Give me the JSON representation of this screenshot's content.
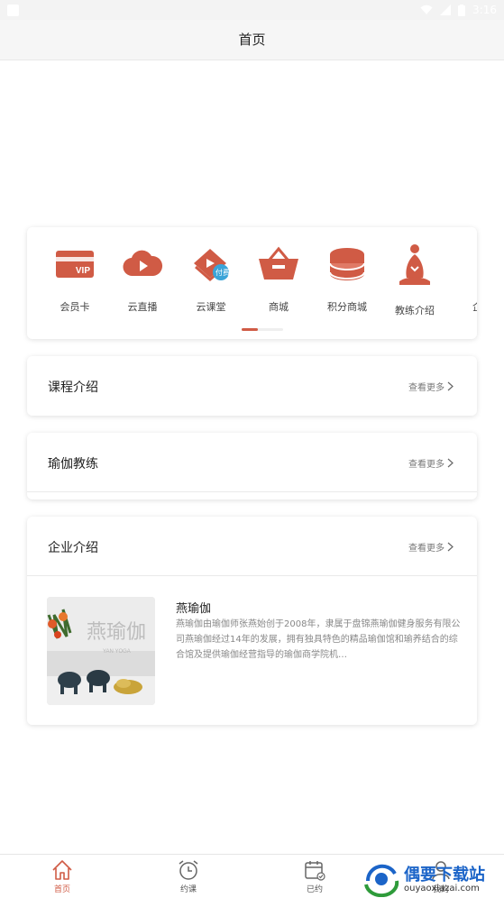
{
  "status_bar": {
    "time": "3:16"
  },
  "header": {
    "title": "首页"
  },
  "menu": {
    "items": [
      {
        "label": "会员卡",
        "icon": "vip-card-icon"
      },
      {
        "label": "云直播",
        "icon": "cloud-live-icon"
      },
      {
        "label": "云课堂",
        "icon": "cloud-class-icon",
        "badge": "付费"
      },
      {
        "label": "商城",
        "icon": "shop-basket-icon"
      },
      {
        "label": "积分商城",
        "icon": "points-coins-icon"
      },
      {
        "label": "教练介绍",
        "icon": "yoga-coach-icon"
      },
      {
        "label": "企业",
        "icon": "company-icon"
      }
    ],
    "vip_text": "VIP"
  },
  "sections": {
    "course": {
      "title": "课程介绍",
      "more": "查看更多"
    },
    "coach": {
      "title": "瑜伽教练",
      "more": "查看更多"
    },
    "company": {
      "title": "企业介绍",
      "more": "查看更多",
      "name": "燕瑜伽",
      "description": "燕瑜伽由瑜伽师张燕始创于2008年，隶属于盘锦燕瑜伽健身服务有限公司燕瑜伽经过14年的发展，拥有独具特色的精品瑜伽馆和瑜养结合的综合馆及提供瑜伽经营指导的瑜伽商学院机…",
      "image_sign": "燕瑜伽",
      "image_sub": "YAN YOGA"
    }
  },
  "tabbar": {
    "tabs": [
      {
        "label": "首页"
      },
      {
        "label": "约课"
      },
      {
        "label": "已约"
      },
      {
        "label": "我的"
      }
    ]
  },
  "watermark": {
    "title": "偶要下载站",
    "url": "ouyaoxiazai.com"
  },
  "colors": {
    "accent": "#d05b45",
    "background": "#ffffff"
  }
}
